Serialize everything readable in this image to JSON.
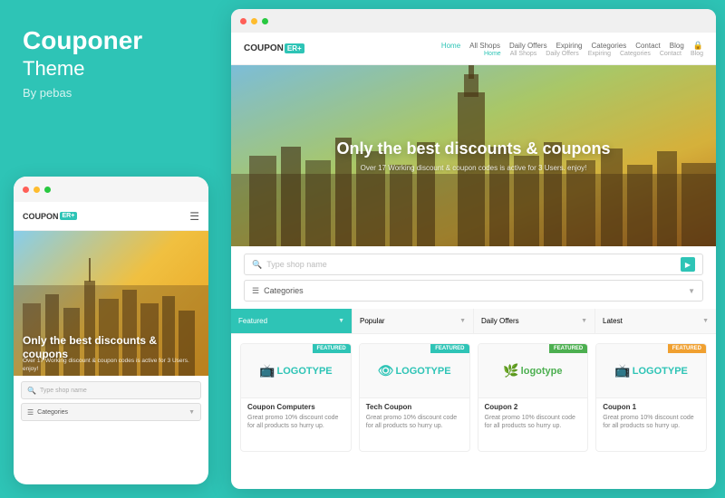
{
  "leftPanel": {
    "brandTitle": "Couponer",
    "brandSubtitle": "Theme",
    "brandAuthor": "By pebas"
  },
  "mobileMockup": {
    "dots": [
      "red",
      "yellow",
      "green"
    ],
    "logo": "COUPON",
    "logoBadge": "ER",
    "heroTitle": "Only the best discounts & coupons",
    "heroSub": "Over 17 Working discount & coupon codes is active for 3 Users. enjoy!",
    "searchPlaceholder": "Type shop name",
    "categoriesLabel": "Categories"
  },
  "desktopMockup": {
    "dots": [
      "red",
      "yellow",
      "green"
    ],
    "nav": {
      "logo": "COUPON",
      "logoBadge": "ER+",
      "links": [
        "Home",
        "All Shops",
        "Daily Offers",
        "Expiring",
        "Categories",
        "Contact",
        "Blog"
      ],
      "activeLink": "Home",
      "subLinks": [
        "Home",
        "All Shops",
        "Daily Offers",
        "Expiring",
        "Categories",
        "Contact",
        "Blog"
      ]
    },
    "hero": {
      "title": "Only the best discounts & coupons",
      "subtitle": "Over 17 Working discount & coupon codes is active for 3 Users. enjoy!"
    },
    "search": {
      "placeholder": "Type shop name",
      "categoriesLabel": "Categories"
    },
    "filterTabs": [
      "Featured",
      "Popular",
      "Daily Offers",
      "Latest"
    ],
    "activeTab": "Featured",
    "cards": [
      {
        "name": "Coupon Computers",
        "desc": "Great promo 10% discount code for all products so hurry up.",
        "badge": "FEATURED",
        "badgeColor": "teal",
        "logoColor": "teal",
        "logoText": "LOGOTYPE"
      },
      {
        "name": "Tech Coupon",
        "desc": "Great promo 10% discount code for all products so hurry up.",
        "badge": "FEATURED",
        "badgeColor": "teal",
        "logoColor": "teal",
        "logoText": "LOGOTYPE"
      },
      {
        "name": "Coupon 2",
        "desc": "Great promo 10% discount code for all products so hurry up.",
        "badge": "FEATURED",
        "badgeColor": "green",
        "logoColor": "green",
        "logoText": "logotype"
      },
      {
        "name": "Coupon 1",
        "desc": "Great promo 10% discount code for all products so hurry up.",
        "badge": "FEATURED",
        "badgeColor": "orange",
        "logoColor": "teal",
        "logoText": "LOGOTYPE"
      }
    ]
  },
  "couponText": "COUPON"
}
